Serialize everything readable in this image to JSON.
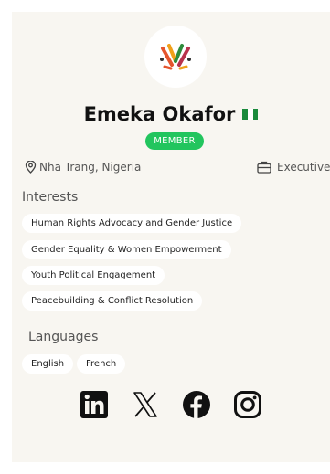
{
  "profile": {
    "name": "Emeka Okafor",
    "badge": "MEMBER",
    "location": "Nha Trang, Nigeria",
    "role": "Executive",
    "flag_colors": [
      "#1a8a3c",
      "#ffffff",
      "#1a8a3c"
    ]
  },
  "interests": {
    "title": "Interests",
    "items": [
      "Human Rights Advocacy and Gender Justice",
      "Gender Equality & Women Empowerment",
      "Youth Political Engagement",
      "Peacebuilding & Conflict Resolution"
    ]
  },
  "languages": {
    "title": "Languages",
    "items": [
      "English",
      "French"
    ]
  },
  "social": {
    "icons": [
      "linkedin-icon",
      "x-icon",
      "facebook-icon",
      "instagram-icon"
    ]
  },
  "colors": {
    "accent": "#22c55e",
    "card_bg": "#f8f6f1"
  }
}
